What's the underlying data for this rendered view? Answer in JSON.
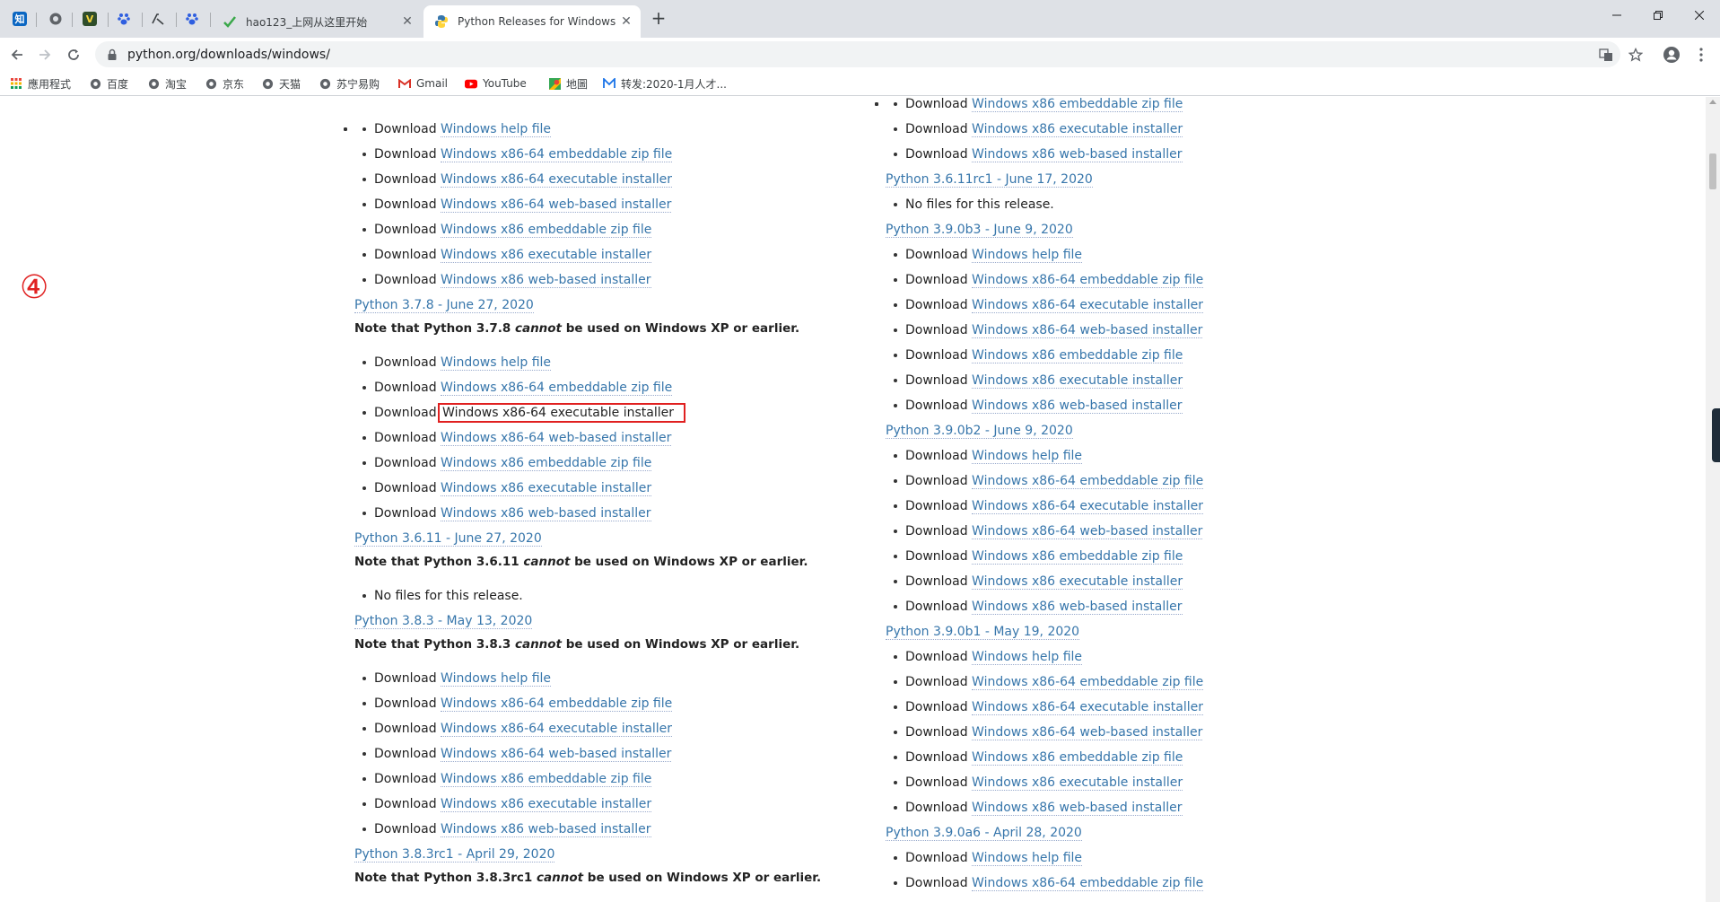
{
  "browser": {
    "tabs": [
      {
        "title": "hao123_上网从这里开始",
        "active": false
      },
      {
        "title": "Python Releases for Windows",
        "active": true
      }
    ],
    "url": "python.org/downloads/windows/",
    "bookmarks": [
      "應用程式",
      "百度",
      "淘宝",
      "京东",
      "天猫",
      "苏宁易购",
      "Gmail",
      "YouTube",
      "地圖",
      "转发:2020-1月人才..."
    ]
  },
  "annotation_marker": "④",
  "labels": {
    "download": "Download",
    "help": "Windows help file",
    "x64_zip": "Windows x86-64 embeddable zip file",
    "x64_exe": "Windows x86-64 executable installer",
    "x64_web": "Windows x86-64 web-based installer",
    "x86_zip": "Windows x86 embeddable zip file",
    "x86_exe": "Windows x86 executable installer",
    "x86_web": "Windows x86 web-based installer",
    "no_files": "No files for this release.",
    "note_prefix": "Note that Python",
    "note_cannot": "cannot",
    "note_suffix": "be used on Windows XP or earlier."
  },
  "left_column": {
    "releases": [
      {
        "title": "Python 3.7.8 - June 27, 2020",
        "version": "3.7.8"
      },
      {
        "title": "Python 3.6.11 - June 27, 2020",
        "version": "3.6.11"
      },
      {
        "title": "Python 3.8.3 - May 13, 2020",
        "version": "3.8.3"
      },
      {
        "title": "Python 3.8.3rc1 - April 29, 2020",
        "version": "3.8.3rc1"
      }
    ]
  },
  "right_column": {
    "releases": [
      {
        "title": "Python 3.6.11rc1 - June 17, 2020"
      },
      {
        "title": "Python 3.9.0b3 - June 9, 2020"
      },
      {
        "title": "Python 3.9.0b2 - June 9, 2020"
      },
      {
        "title": "Python 3.9.0b1 - May 19, 2020"
      },
      {
        "title": "Python 3.9.0a6 - April 28, 2020"
      }
    ]
  }
}
